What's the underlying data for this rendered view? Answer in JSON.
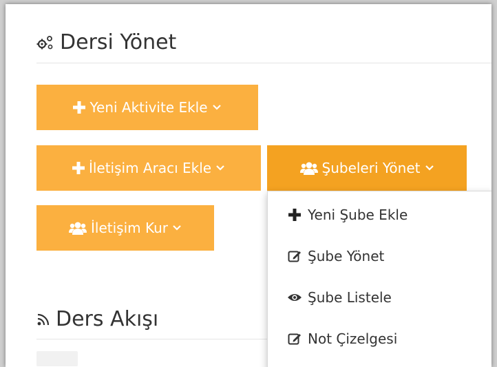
{
  "manage": {
    "title": "Dersi Yönet",
    "icon": "cogs-icon"
  },
  "buttons": {
    "new_activity": "Yeni Aktivite Ekle",
    "communication_tool": "İletişim Aracı Ekle",
    "manage_sections": "Şubeleri Yönet",
    "communicate": "İletişim Kur"
  },
  "dropdown": {
    "items": [
      {
        "label": "Yeni Şube Ekle",
        "icon": "plus-icon"
      },
      {
        "label": "Şube Yönet",
        "icon": "edit-icon"
      },
      {
        "label": "Şube Listele",
        "icon": "eye-icon"
      },
      {
        "label": "Not Çizelgesi",
        "icon": "edit-icon"
      }
    ]
  },
  "feed": {
    "title": "Ders Akışı",
    "icon": "rss-icon"
  },
  "colors": {
    "button": "#fbb040",
    "button_active": "#f4a221",
    "text": "#333333"
  }
}
